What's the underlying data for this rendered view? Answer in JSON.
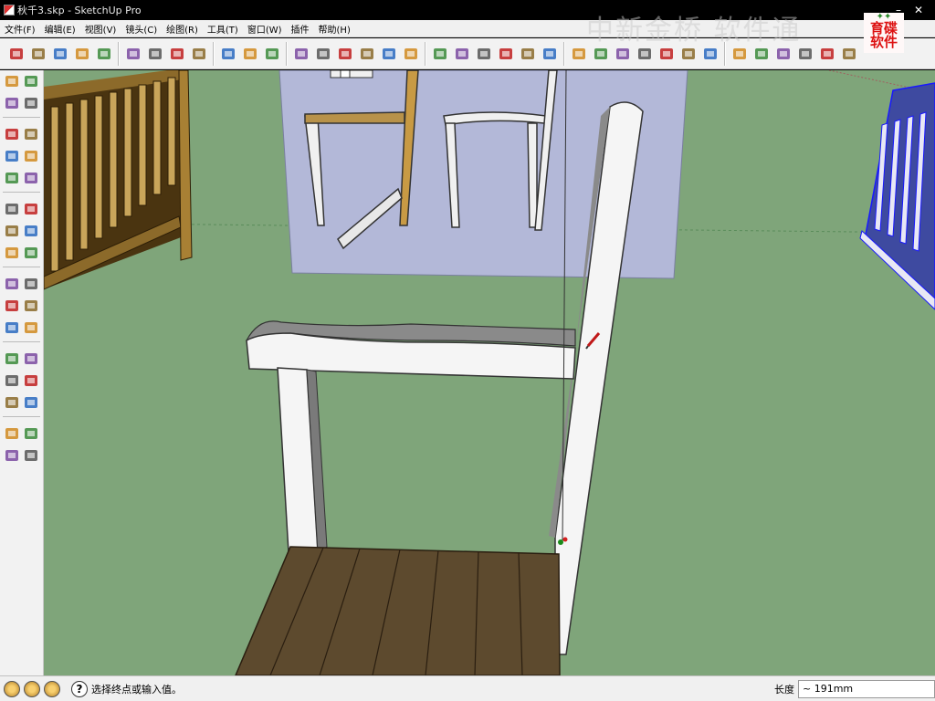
{
  "window": {
    "title": "秋千3.skp - SketchUp Pro"
  },
  "menu": [
    {
      "label": "文件(F)"
    },
    {
      "label": "编辑(E)"
    },
    {
      "label": "视图(V)"
    },
    {
      "label": "镜头(C)"
    },
    {
      "label": "绘图(R)"
    },
    {
      "label": "工具(T)"
    },
    {
      "label": "窗口(W)"
    },
    {
      "label": "插件"
    },
    {
      "label": "帮助(H)"
    }
  ],
  "watermark": "中新金桥 软件通",
  "logo": {
    "line1": "育碟",
    "line2": "软件"
  },
  "status": {
    "prompt": "选择终点或输入值。",
    "vcb_label": "长度",
    "vcb_value": "~ 191mm"
  },
  "colors": {
    "ground": "#7fa57a",
    "wall": "#b3b8d8",
    "chair": "#f5f5f5",
    "seat": "#5d4a2e",
    "fence": "#6b4a1e"
  },
  "toolbar_top_icons": [
    "select-icon",
    "pencil-icon",
    "rectangle-icon",
    "circle-icon",
    "arc-icon",
    "make-component-icon",
    "eraser-icon",
    "tape-measure-icon",
    "paint-bucket-icon",
    "push-pull-icon",
    "move-icon",
    "rotate-icon",
    "follow-me-icon",
    "orbit-icon",
    "pan-icon",
    "zoom-icon",
    "zoom-extents-icon",
    "previous-view-icon",
    "next-view-icon",
    "place-model-icon",
    "get-models-icon",
    "share-model-icon",
    "components-icon",
    "photo-textures-icon",
    "home-view-icon",
    "iso-view-icon",
    "top-view-icon",
    "front-view-icon",
    "right-view-icon",
    "back-view-icon",
    "left-view-icon",
    "xray-icon",
    "wireframe-icon",
    "hidden-line-icon",
    "shaded-icon",
    "shaded-texture-icon",
    "monochrome-icon"
  ],
  "toolbar_left_icons": [
    "select-icon",
    "make-component-icon",
    "paint-bucket-icon",
    "eraser-icon",
    "rectangle-icon",
    "line-icon",
    "circle-icon",
    "arc-icon",
    "polygon-icon",
    "freehand-icon",
    "move-icon",
    "push-pull-icon",
    "rotate-icon",
    "follow-me-icon",
    "scale-icon",
    "offset-icon",
    "tape-measure-icon",
    "dimension-icon",
    "protractor-icon",
    "text-icon",
    "axes-icon",
    "3d-text-icon",
    "orbit-icon",
    "pan-icon",
    "zoom-icon",
    "zoom-window-icon",
    "previous-icon",
    "zoom-extents-icon",
    "position-camera-icon",
    "look-around-icon",
    "walk-icon",
    "section-plane-icon"
  ]
}
